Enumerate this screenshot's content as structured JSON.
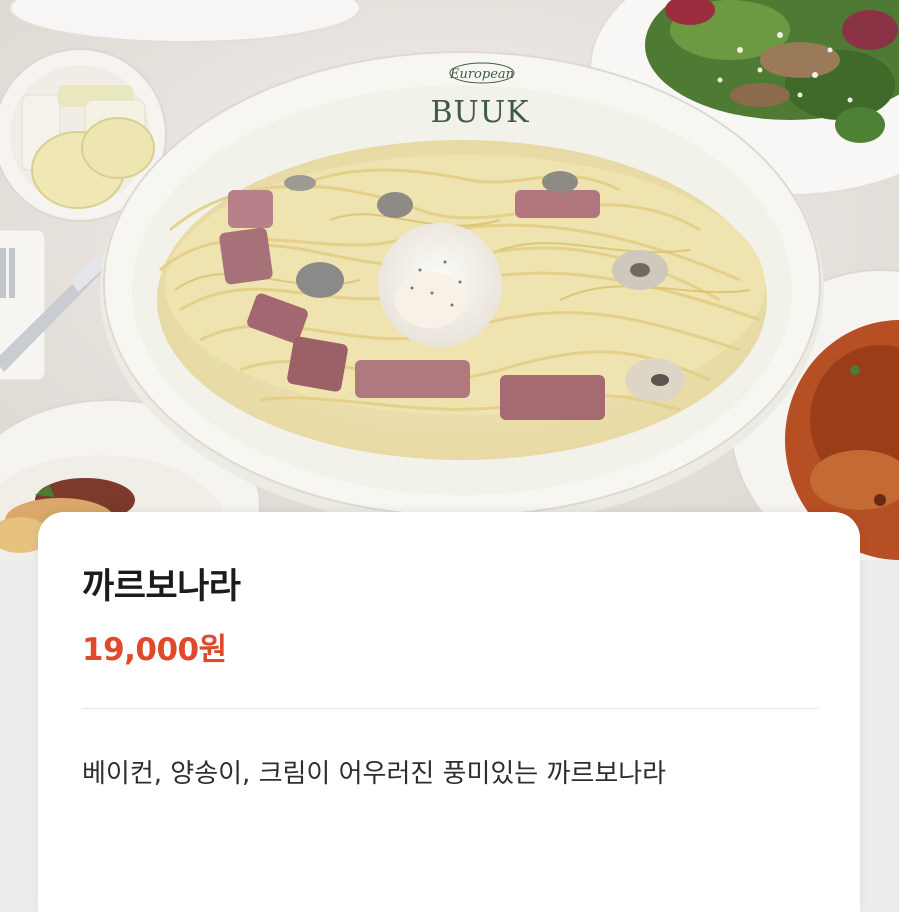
{
  "photo": {
    "description_icon": "food-photo",
    "plate_logo_top": "European",
    "plate_logo_main": "BUUK"
  },
  "menu_item": {
    "name": "까르보나라",
    "price": "19,000원",
    "description": "베이컨, 양송이, 크림이 어우러진 풍미있는 까르보나라"
  },
  "colors": {
    "price": "#e0492c",
    "card_background": "#ffffff",
    "page_background": "#ececec"
  }
}
